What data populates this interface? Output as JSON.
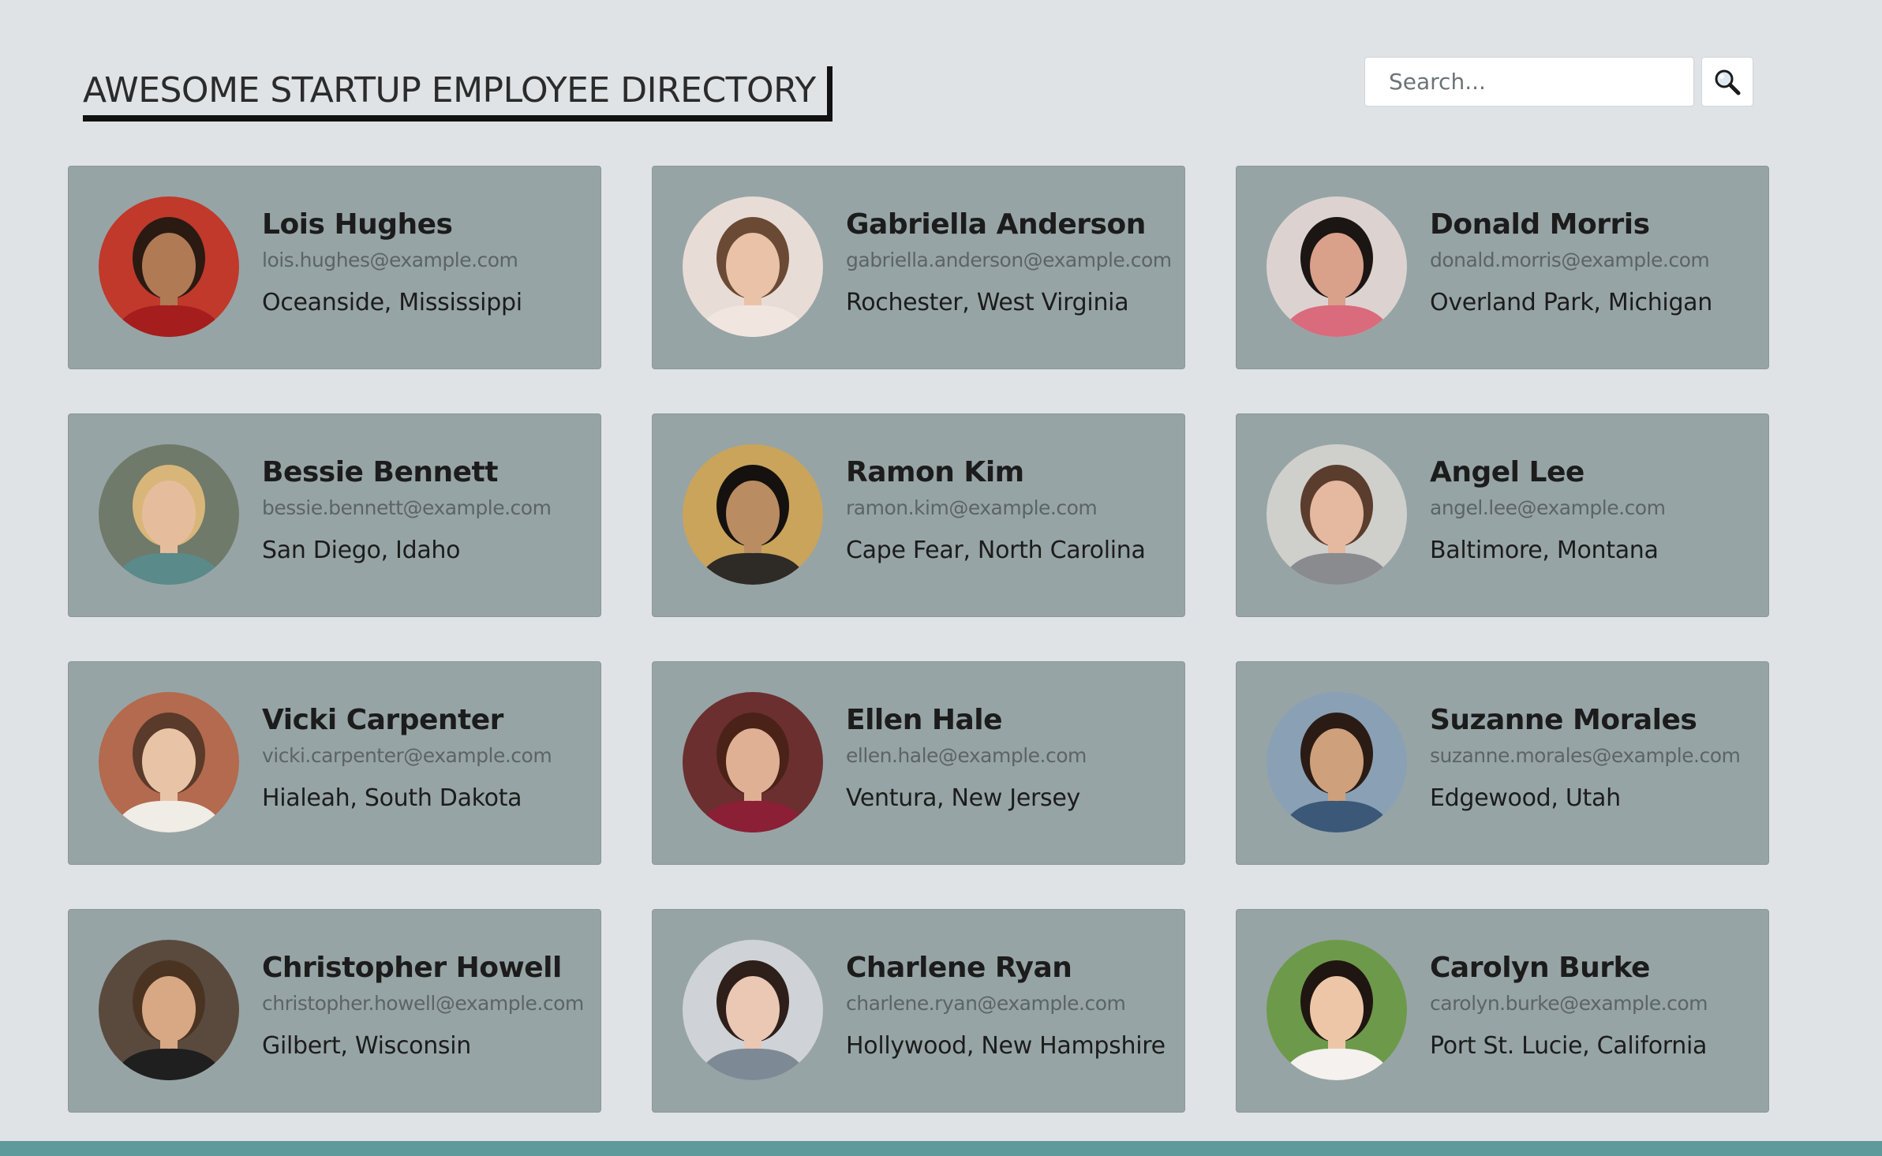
{
  "header": {
    "title": "AWESOME STARTUP EMPLOYEE DIRECTORY",
    "search_placeholder": "Search...",
    "search_icon": "search-icon"
  },
  "employees": [
    {
      "name": "Lois Hughes",
      "email": "lois.hughes@example.com",
      "location": "Oceanside, Mississippi",
      "avatar": {
        "bg": "#c0392b",
        "skin": "#b07a55",
        "hair": "#2a1a12",
        "shirt": "#a61d1d"
      }
    },
    {
      "name": "Gabriella Anderson",
      "email": "gabriella.anderson@example.com",
      "location": "Rochester, West Virginia",
      "avatar": {
        "bg": "#e8dcd6",
        "skin": "#eac2a8",
        "hair": "#6a4a34",
        "shirt": "#f1e6df"
      }
    },
    {
      "name": "Donald Morris",
      "email": "donald.morris@example.com",
      "location": "Overland Park, Michigan",
      "avatar": {
        "bg": "#dcd3d0",
        "skin": "#d9a08a",
        "hair": "#1b1514",
        "shirt": "#d96b7c"
      }
    },
    {
      "name": "Bessie Bennett",
      "email": "bessie.bennett@example.com",
      "location": "San Diego, Idaho",
      "avatar": {
        "bg": "#6f7a6a",
        "skin": "#e6bd9c",
        "hair": "#d8b679",
        "shirt": "#5a8a8a"
      }
    },
    {
      "name": "Ramon Kim",
      "email": "ramon.kim@example.com",
      "location": "Cape Fear, North Carolina",
      "avatar": {
        "bg": "#c9a45a",
        "skin": "#b98c62",
        "hair": "#15110f",
        "shirt": "#2e2a26"
      }
    },
    {
      "name": "Angel Lee",
      "email": "angel.lee@example.com",
      "location": "Baltimore, Montana",
      "avatar": {
        "bg": "#cfd0cc",
        "skin": "#e4b9a0",
        "hair": "#5a3d2c",
        "shirt": "#8a8b8f"
      }
    },
    {
      "name": "Vicki Carpenter",
      "email": "vicki.carpenter@example.com",
      "location": "Hialeah, South Dakota",
      "avatar": {
        "bg": "#b36a4e",
        "skin": "#e9c3a6",
        "hair": "#5a3a2a",
        "shirt": "#f0ece6"
      }
    },
    {
      "name": "Ellen Hale",
      "email": "ellen.hale@example.com",
      "location": "Ventura, New Jersey",
      "avatar": {
        "bg": "#6b2f2f",
        "skin": "#e0b094",
        "hair": "#4a2218",
        "shirt": "#8b1f36"
      }
    },
    {
      "name": "Suzanne Morales",
      "email": "suzanne.morales@example.com",
      "location": "Edgewood, Utah",
      "avatar": {
        "bg": "#8aa0b5",
        "skin": "#cfa07c",
        "hair": "#2a1c14",
        "shirt": "#3c5878"
      }
    },
    {
      "name": "Christopher Howell",
      "email": "christopher.howell@example.com",
      "location": "Gilbert, Wisconsin",
      "avatar": {
        "bg": "#5a4a3e",
        "skin": "#d8a884",
        "hair": "#4b3322",
        "shirt": "#1f1f1f"
      }
    },
    {
      "name": "Charlene Ryan",
      "email": "charlene.ryan@example.com",
      "location": "Hollywood, New Hampshire",
      "avatar": {
        "bg": "#cfd2d6",
        "skin": "#eac8b4",
        "hair": "#2e1f1a",
        "shirt": "#7d8a95"
      }
    },
    {
      "name": "Carolyn Burke",
      "email": "carolyn.burke@example.com",
      "location": "Port St. Lucie, California",
      "avatar": {
        "bg": "#6d9a4a",
        "skin": "#ecc6a6",
        "hair": "#1f1611",
        "shirt": "#f4f1ee"
      }
    }
  ]
}
